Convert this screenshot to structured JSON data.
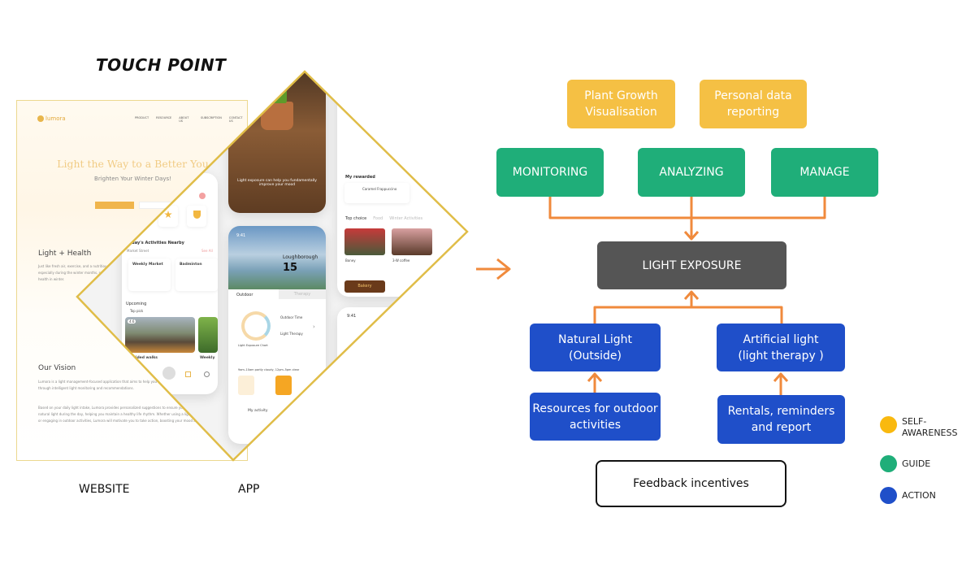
{
  "touchpoint": {
    "title": "TOUCH POINT",
    "website_label": "WEBSITE",
    "app_label": "APP"
  },
  "website": {
    "logo": "lumora",
    "nav": [
      "PRODUCT",
      "RESOURCE",
      "ABOUT US",
      "SUBSCRIPTION",
      "CONTACT US"
    ],
    "hero_title": "Light the Way to a Better You",
    "hero_subtitle": "Brighten Your Winter Days!",
    "section1_title": "Light + Health",
    "section1_text": "Just like fresh air, exercise, and a nutritious diet, natural light is an integral part of our daily lives, especially during the winter months, supporting sleep quality, emotional stability and optimal health in winter.",
    "section2_title": "Our Vision",
    "section2_text1": "Lumora is a light management-focused application that aims to help you enjoy the best quality of life during the winter through intelligent light monitoring and recommendations.",
    "section2_text2": "Based on your daily light intake, Lumora provides personalized suggestions to ensure your body absorbs enough natural light during the day, helping you maintain a healthy life rhythm. Whether using a light therapy lamp at home or engaging in outdoor activities, Lumora will motivate you to take action, boosting your mood and energy levels."
  },
  "app": {
    "phone1": {
      "section_title": "Today's Activities Nearby",
      "location": "Market Street",
      "see_all": "See All",
      "cards": [
        "Weekly Market",
        "Badminton"
      ],
      "upcoming": "Upcoming",
      "top_pick": "Top pick",
      "rating": "4.6",
      "event": "Guided walks",
      "event2": "Weekly"
    },
    "phone2": {
      "caption": "Light exposure can help you fundamentally improve your mood",
      "time": "9:41",
      "city": "Loughborough",
      "temp": "15",
      "tab_outdoor": "Outdoor",
      "tab_therapy": "Therapy",
      "outdoor_time": "Outdoor Time",
      "light_therapy": "Light Therapy",
      "chart_label": "Light Exposure Chart",
      "forecast": "9am–10am partly cloudy, 12pm–5pm clear",
      "my_activity": "My activity"
    },
    "phone3": {
      "rewarded": "My rewarded",
      "reward_item": "Caramel Frappuccino",
      "tabs": [
        "Top choice",
        "Food",
        "Winter Activities"
      ],
      "shops": [
        "Boney",
        "3-W coffee"
      ],
      "bakery": "Bakery"
    },
    "phone4": {
      "time": "9:41"
    }
  },
  "diagram": {
    "self_awareness": [
      "Plant Growth Visualisation",
      "Personal data reporting"
    ],
    "guide": [
      "MONITORING",
      "ANALYZING",
      "MANAGE"
    ],
    "center": "LIGHT EXPOSURE",
    "action_top": [
      "Natural Light (Outside)",
      "Artificial light (light therapy )"
    ],
    "action_bottom": [
      "Resources for outdoor activities",
      "Rentals, reminders and report"
    ],
    "feedback": "Feedback incentives"
  },
  "legend": [
    {
      "label": "SELF-AWARENESS",
      "color": "#f9b90f"
    },
    {
      "label": "GUIDE",
      "color": "#1fae79"
    },
    {
      "label": "ACTION",
      "color": "#1f4fc9"
    }
  ],
  "colors": {
    "connector": "#f08a3c",
    "accent": "#e8b64c"
  }
}
